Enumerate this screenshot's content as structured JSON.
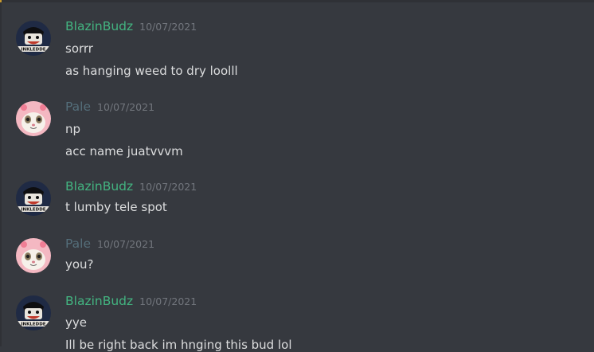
{
  "messages": [
    {
      "author": "BlazinBudz",
      "timestamp": "10/07/2021",
      "lines": [
        "sorrr",
        "as hanging weed to dry loolll"
      ]
    },
    {
      "author": "Pale",
      "timestamp": "10/07/2021",
      "lines": [
        "np",
        "acc name juatvvvm"
      ]
    },
    {
      "author": "BlazinBudz",
      "timestamp": "10/07/2021",
      "lines": [
        "t lumby tele spot"
      ]
    },
    {
      "author": "Pale",
      "timestamp": "10/07/2021",
      "lines": [
        "you?"
      ]
    },
    {
      "author": "BlazinBudz",
      "timestamp": "10/07/2021",
      "lines": [
        "yye",
        "Ill be right back im hnging this bud lol"
      ]
    }
  ],
  "avatars": {
    "blazin": {
      "icon": "cartoon-face-avatar",
      "badge_text": "INKLEDDE"
    },
    "pale": {
      "icon": "cat-in-pink-hood-avatar"
    }
  },
  "colors": {
    "background": "#36393f",
    "blazin_name": "#43b581",
    "pale_name": "#546e7a",
    "timestamp": "#72767d",
    "message_text": "#dcddde"
  }
}
